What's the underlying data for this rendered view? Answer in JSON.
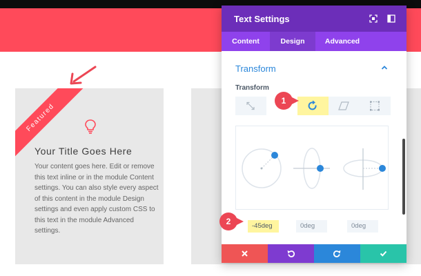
{
  "page": {
    "card": {
      "ribbon": "Featured",
      "title": "Your Title Goes Here",
      "body": "Your content goes here. Edit or remove this text inline or in the module Content settings. You can also style every aspect of this content in the module Design settings and even apply custom CSS to this text in the module Advanced settings."
    }
  },
  "panel": {
    "title": "Text Settings",
    "header_icons": [
      "expand-icon",
      "sidebar-toggle-icon"
    ],
    "tabs": [
      {
        "label": "Content",
        "active": false
      },
      {
        "label": "Design",
        "active": true
      },
      {
        "label": "Advanced",
        "active": false
      }
    ],
    "section": {
      "title": "Transform",
      "sub_label": "Transform",
      "tools": [
        "scale-icon",
        "rotate-icon",
        "skew-icon",
        "origin-icon"
      ],
      "active_tool": "rotate-icon",
      "fields": [
        {
          "value": "-45deg",
          "highlighted": true
        },
        {
          "value": "0deg",
          "highlighted": false
        },
        {
          "value": "0deg",
          "highlighted": false
        }
      ]
    },
    "footer": [
      {
        "name": "discard-button",
        "icon": "close-icon",
        "color": "#ef5555"
      },
      {
        "name": "undo-button",
        "icon": "undo-icon",
        "color": "#7e3bd0"
      },
      {
        "name": "redo-button",
        "icon": "redo-icon",
        "color": "#2b87da"
      },
      {
        "name": "save-button",
        "icon": "check-icon",
        "color": "#29c4a9"
      }
    ]
  },
  "annotations": {
    "badge_1": "1",
    "badge_2": "2"
  },
  "colors": {
    "hero": "#ff4a5a",
    "panel_header": "#6c2eb9",
    "panel_tabs": "#8f42ec",
    "accent_blue": "#2b87da",
    "highlight": "#fff59f",
    "badge": "#ec4654"
  }
}
